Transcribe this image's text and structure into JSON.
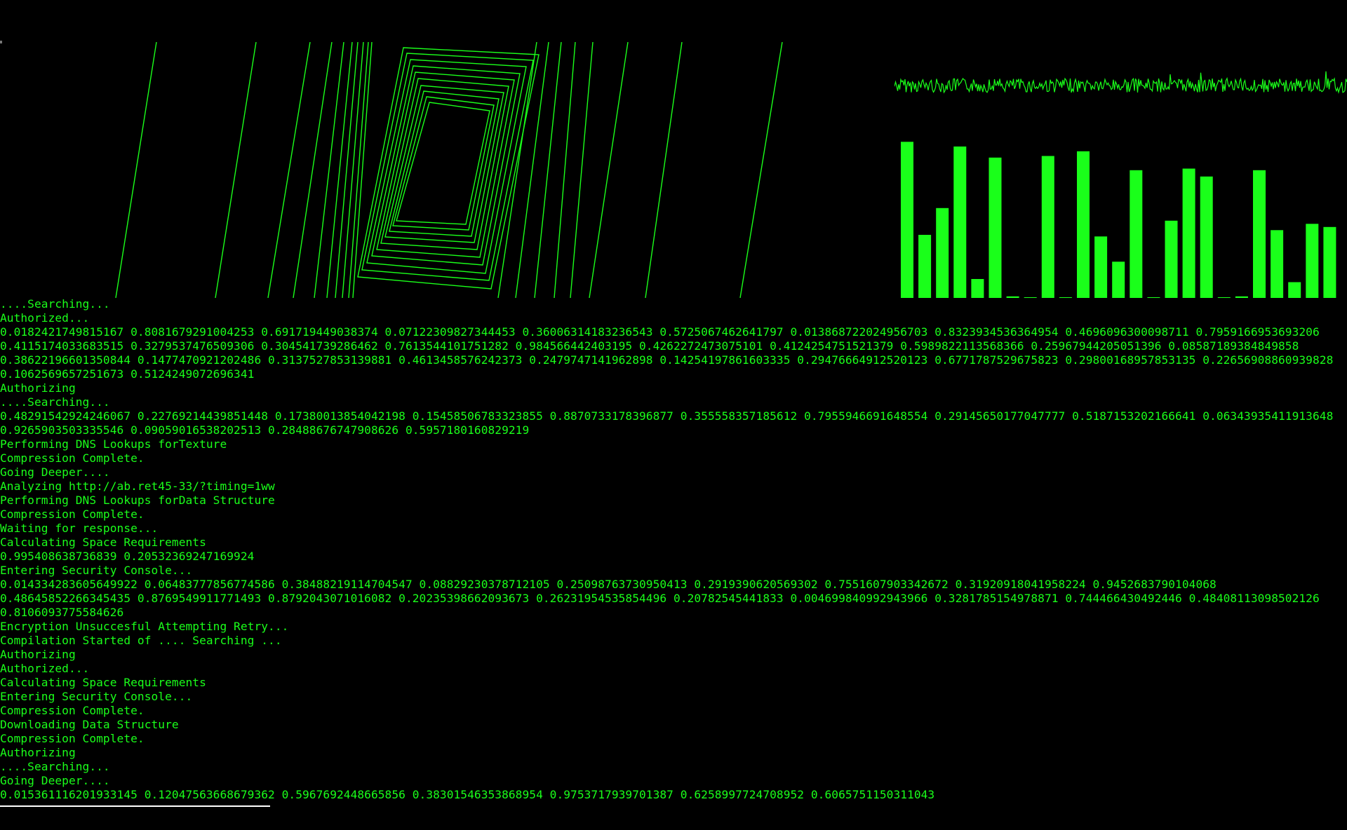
{
  "colors": {
    "accent": "#1aff1a",
    "background": "#000000",
    "cursor": "#ffffff"
  },
  "waveform": {
    "style": "noise",
    "color": "#1aff1a"
  },
  "bar_graph": {
    "levels": [
      0.99,
      0.4,
      0.57,
      0.96,
      0.12,
      0.89,
      0.01,
      0.0,
      0.9,
      0.0,
      0.93,
      0.39,
      0.23,
      0.81,
      0.0,
      0.49,
      0.82,
      0.77,
      0.0,
      0.01,
      0.81,
      0.43,
      0.1,
      0.47,
      0.45
    ],
    "color": "#1aff1a"
  },
  "log_lines": [
    "....Searching...",
    "Authorized...",
    "0.0182421749815167 0.8081679291004253 0.691719449038374 0.07122309827344453 0.36006314183236543 0.5725067462641797 0.013868722024956703 0.8323934536364954 0.4696096300098711 0.7959166953693206",
    "0.4115174033683515 0.3279537476509306 0.304541739286462 0.7613544101751282 0.984566442403195 0.4262272473075101 0.4124254751521379 0.5989822113568366 0.25967944205051396 0.08587189384849858",
    "0.38622196601350844 0.1477470921202486 0.3137527853139881 0.4613458576242373 0.2479747141962898 0.14254197861603335 0.29476664912520123 0.6771787529675823 0.29800168957853135 0.22656908860939828",
    "0.1062569657251673 0.5124249072696341",
    "Authorizing",
    "....Searching...",
    "0.48291542924246067 0.22769214439851448 0.17380013854042198 0.15458506783323855 0.8870733178396877 0.355558357185612 0.7955946691648554 0.29145650177047777 0.5187153202166641 0.06343935411913648",
    "0.9265903503335546 0.09059016538202513 0.28488676747908626 0.5957180160829219",
    "Performing DNS Lookups forTexture",
    "Compression Complete.",
    "Going Deeper....",
    "Analyzing http://ab.ret45-33/?timing=1ww",
    "Performing DNS Lookups forData Structure",
    "Compression Complete.",
    "Waiting for response...",
    "Calculating Space Requirements",
    "0.995408638736839 0.20532369247169924",
    "Entering Security Console...",
    "0.014334283605649922 0.06483777856774586 0.38488219114704547 0.08829230378712105 0.25098763730950413 0.2919390620569302 0.7551607903342672 0.31920918041958224 0.9452683790104068",
    "0.48645852266345435 0.8769549911771493 0.8792043071016082 0.20235398662093673 0.26231954535854496 0.20782545441833 0.004699840992943966 0.3281785154978871 0.744466430492446 0.48408113098502126",
    "0.8106093775584626",
    "Encryption Unsuccesful Attempting Retry...",
    "Compilation Started of .... Searching ...",
    "Authorizing",
    "Authorized...",
    "Calculating Space Requirements",
    "Entering Security Console...",
    "Compression Complete.",
    "Downloading Data Structure",
    "Compression Complete.",
    "Authorizing",
    "....Searching...",
    "Going Deeper....",
    "0.015361116201933145 0.12047563668679362 0.5967692448665856 0.38301546353868954 0.9753717939701387 0.6258997724708952 0.6065751150311043"
  ]
}
